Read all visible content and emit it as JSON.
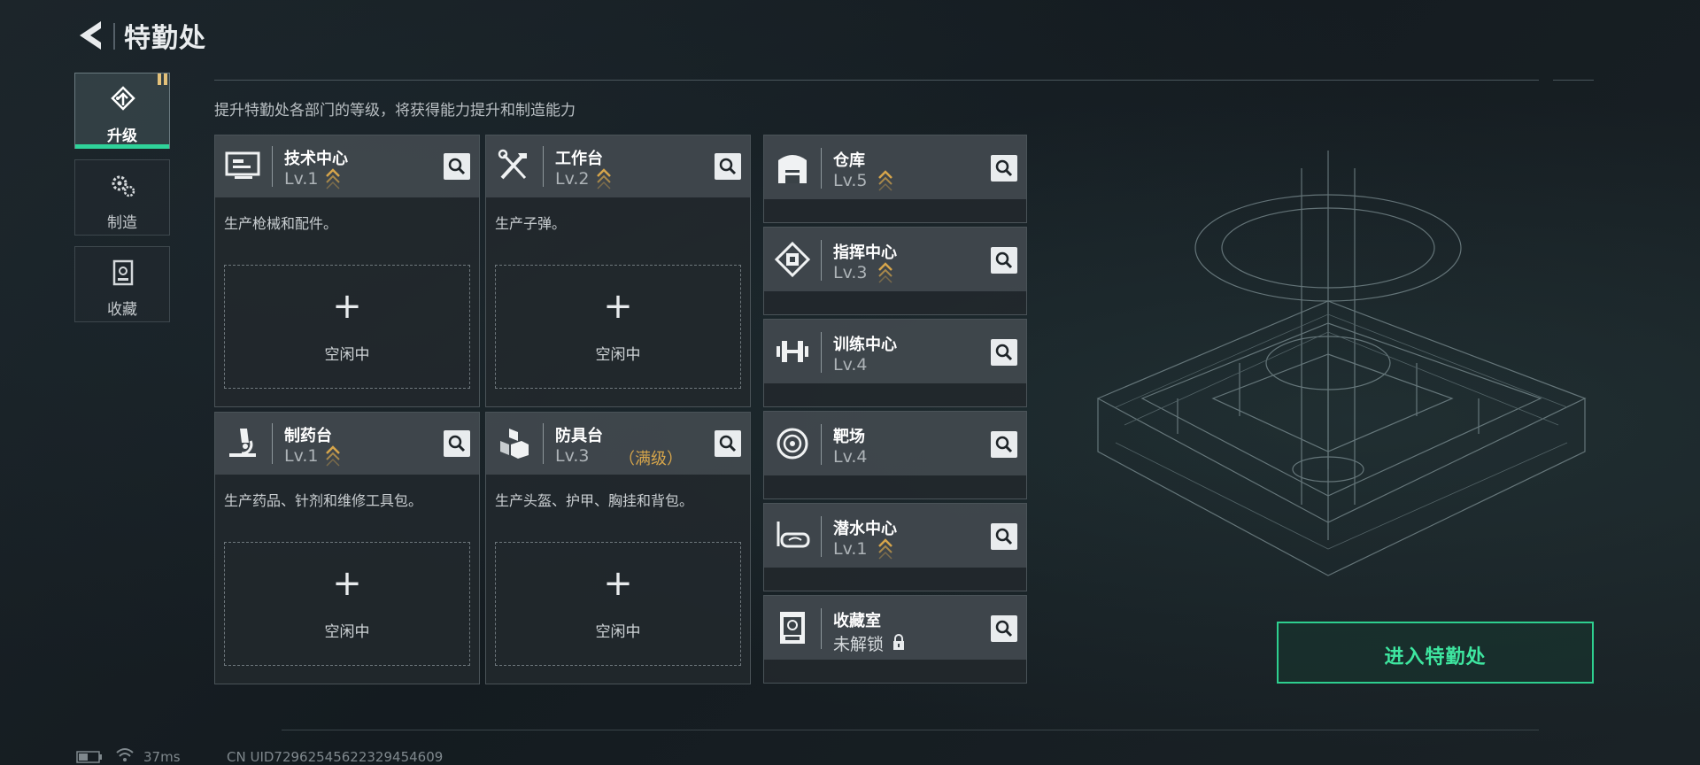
{
  "header": {
    "title": "特勤处"
  },
  "subtitle": "提升特勤处各部门的等级，将获得能力提升和制造能力",
  "tabs": [
    {
      "label": "升级",
      "icon": "upgrade-icon",
      "active": true
    },
    {
      "label": "制造",
      "icon": "gears-icon",
      "active": false
    },
    {
      "label": "收藏",
      "icon": "collection-icon",
      "active": false
    }
  ],
  "cards": [
    {
      "name": "技术中心",
      "level": "Lv.1",
      "desc": "生产枪械和配件。",
      "plus": "+",
      "status": "空闲中",
      "icon": "monitor-icon"
    },
    {
      "name": "工作台",
      "level": "Lv.2",
      "desc": "生产子弹。",
      "plus": "+",
      "status": "空闲中",
      "icon": "tools-icon"
    },
    {
      "name": "制药台",
      "level": "Lv.1",
      "desc": "生产药品、针剂和维修工具包。",
      "plus": "+",
      "status": "空闲中",
      "icon": "microscope-icon"
    },
    {
      "name": "防具台",
      "level": "Lv.3",
      "max_tag": "（满级）",
      "desc": "生产头盔、护甲、胸挂和背包。",
      "plus": "+",
      "status": "空闲中",
      "icon": "armor-boxes-icon"
    }
  ],
  "facilities": [
    {
      "name": "仓库",
      "level": "Lv.5",
      "upgradable": true,
      "icon": "warehouse-icon"
    },
    {
      "name": "指挥中心",
      "level": "Lv.3",
      "upgradable": true,
      "icon": "command-chip-icon"
    },
    {
      "name": "训练中心",
      "level": "Lv.4",
      "upgradable": false,
      "icon": "dumbbell-icon"
    },
    {
      "name": "靶场",
      "level": "Lv.4",
      "upgradable": false,
      "icon": "target-icon"
    },
    {
      "name": "潜水中心",
      "level": "Lv.1",
      "upgradable": true,
      "icon": "diving-mask-icon"
    },
    {
      "name": "收藏室",
      "level": "未解锁",
      "locked": true,
      "icon": "collection-room-icon"
    }
  ],
  "enter_button": "进入特勤处",
  "status_bar": {
    "latency": "37ms",
    "uid": "CN UID7296254562232945460​9"
  },
  "colors": {
    "accent": "#2fd39a",
    "upgrade": "#d6a54b",
    "text": "#d6d9dc"
  }
}
